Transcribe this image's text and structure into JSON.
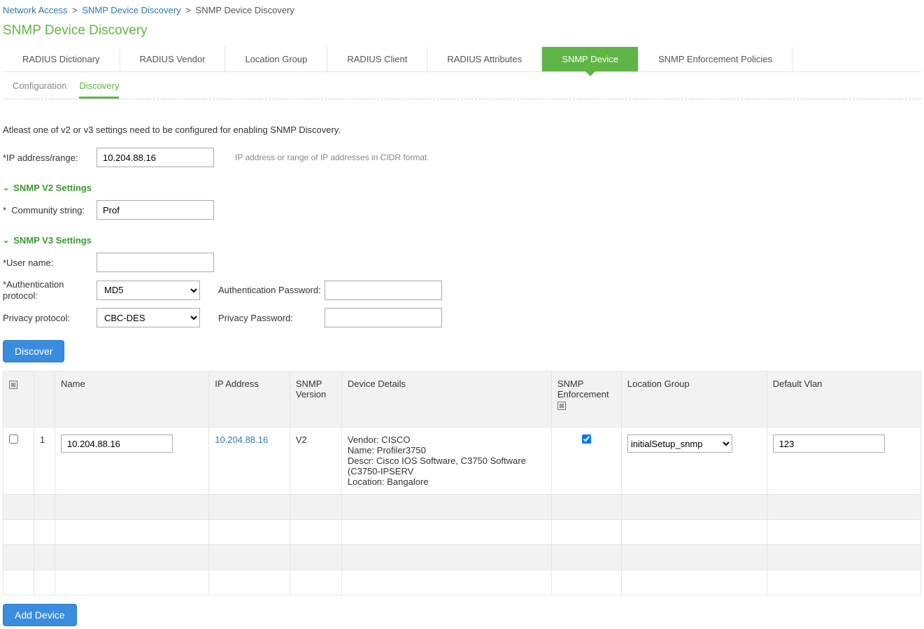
{
  "breadcrumb": {
    "items": [
      {
        "label": "Network Access",
        "link": true
      },
      {
        "label": "SNMP Device Discovery",
        "link": true
      },
      {
        "label": "SNMP Device Discovery",
        "link": false
      }
    ]
  },
  "page_title": "SNMP Device Discovery",
  "main_tabs": [
    {
      "label": "RADIUS Dictionary"
    },
    {
      "label": "RADIUS Vendor"
    },
    {
      "label": "Location Group"
    },
    {
      "label": "RADIUS Client"
    },
    {
      "label": "RADIUS Attributes"
    },
    {
      "label": "SNMP Device",
      "active": true
    },
    {
      "label": "SNMP Enforcement Policies"
    }
  ],
  "sub_tabs": [
    {
      "label": "Configuration"
    },
    {
      "label": "Discovery",
      "active": true
    }
  ],
  "info_text": "Atleast one of v2 or v3 settings need to be configured for enabling SNMP Discovery.",
  "form": {
    "ip_range_label": "*IP address/range:",
    "ip_range_value": "10.204.88.16",
    "ip_range_hint": "IP address or range of IP addresses in CIDR format.",
    "v2_header": "SNMP V2 Settings",
    "community_label": "Community string:",
    "community_value": "Prof",
    "v3_header": "SNMP V3 Settings",
    "username_label": "*User name:",
    "username_value": "",
    "auth_proto_label": "Authentication protocol:",
    "auth_proto_value": "MD5",
    "auth_pass_label": "Authentication Password:",
    "auth_pass_value": "",
    "priv_proto_label": "Privacy protocol:",
    "priv_proto_value": "CBC-DES",
    "priv_pass_label": "Privacy Password:",
    "priv_pass_value": ""
  },
  "discover_label": "Discover",
  "table": {
    "headers": {
      "row_num": "",
      "name": "Name",
      "ip": "IP Address",
      "version": "SNMP Version",
      "details": "Device Details",
      "enforcement": "SNMP Enforcement",
      "location": "Location Group",
      "vlan": "Default Vlan"
    },
    "rows": [
      {
        "num": "1",
        "name": "10.204.88.16",
        "ip": "10.204.88.16",
        "version": "V2",
        "details": "Vendor: CISCO\nName: Profiler3750\nDescr: Cisco IOS Software, C3750 Software (C3750-IPSERV\nLocation: Bangalore",
        "enforcement_checked": true,
        "location": "initialSetup_snmp",
        "vlan": "123"
      }
    ]
  },
  "add_device_label": "Add Device"
}
